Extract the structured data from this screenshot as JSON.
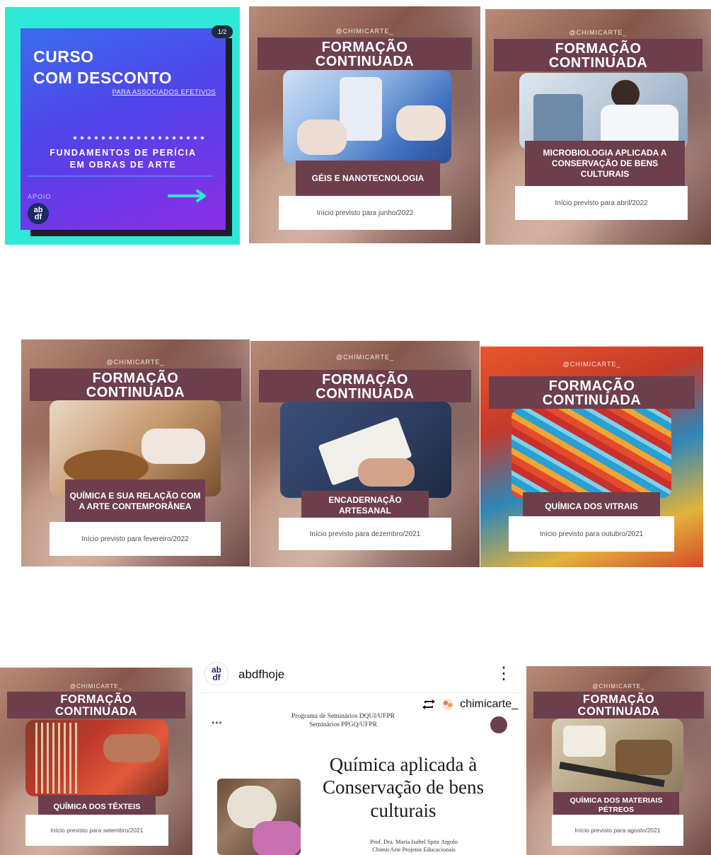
{
  "promo": {
    "page_badge": "1/2",
    "heading_line1": "CURSO",
    "heading_line2": "COM DESCONTO",
    "subheading": "PARA ASSOCIADOS EFETIVOS",
    "course_line1": "FUNDAMENTOS DE PERÍCIA",
    "course_line2": "EM OBRAS DE ARTE",
    "support_label": "APOIO",
    "logo_top": "ab",
    "logo_bottom": "df"
  },
  "posts": [
    {
      "handle": "@CHIMICARTE_",
      "banner1": "FORMAÇÃO",
      "banner2": "CONTINUADA",
      "title": "GÉIS E NANOTECNOLOGIA",
      "date": "Início previsto para junho/2022"
    },
    {
      "handle": "@CHIMICARTE_",
      "banner1": "FORMAÇÃO",
      "banner2": "CONTINUADA",
      "title": "MICROBIOLOGIA APLICADA A CONSERVAÇÃO DE BENS CULTURAIS",
      "date": "Início previsto para abril/2022"
    },
    {
      "handle": "@CHIMICARTE_",
      "banner1": "FORMAÇÃO",
      "banner2": "CONTINUADA",
      "title": "QUÍMICA E SUA RELAÇÃO COM A ARTE CONTEMPORÂNEA",
      "date": "Início previsto para fevereiro/2022"
    },
    {
      "handle": "@CHIMICARTE_",
      "banner1": "FORMAÇÃO",
      "banner2": "CONTINUADA",
      "title": "ENCADERNAÇÃO ARTESANAL",
      "date": "Início previsto para dezembro/2021"
    },
    {
      "handle": "@CHIMICARTE_",
      "banner1": "FORMAÇÃO",
      "banner2": "CONTINUADA",
      "title": "QUÍMICA DOS VITRAIS",
      "date": "Início previsto para outubro/2021"
    },
    {
      "handle": "@CHIMICARTE_",
      "banner1": "FORMAÇÃO",
      "banner2": "CONTINUADA",
      "title": "QUÍMICA DOS TÊXTEIS",
      "date": "Início previsto para setembro/2021"
    },
    {
      "handle": "@CHIMICARTE_",
      "banner1": "FORMAÇÃO",
      "banner2": "CONTINUADA",
      "title": "QUÍMICA DOS MATERIAIS PÉTREOS",
      "date": "Início previsto para agosto/2021"
    }
  ],
  "instagram": {
    "avatar_top": "ab",
    "avatar_bottom": "df",
    "username": "abdfhoje",
    "more_glyph": "⋮",
    "repost_user": "chimicarte_",
    "dots": "•••",
    "program_line1": "Programa de Seminários DQUI/UFPR",
    "program_line2": "Seminários PPGQ/UFPR",
    "title_line1": "Química aplicada à",
    "title_line2": "Conservação de bens",
    "title_line3": "culturais",
    "author_line1": "Prof. Dra. Maria Isabel Spitz Argolo",
    "author_line2": "ChimicArte Projetos Educacionais"
  },
  "colors": {
    "banner": "#6d3f4c",
    "promo_bg": "#30e8d6",
    "promo_arrow": "#30e8d6"
  }
}
